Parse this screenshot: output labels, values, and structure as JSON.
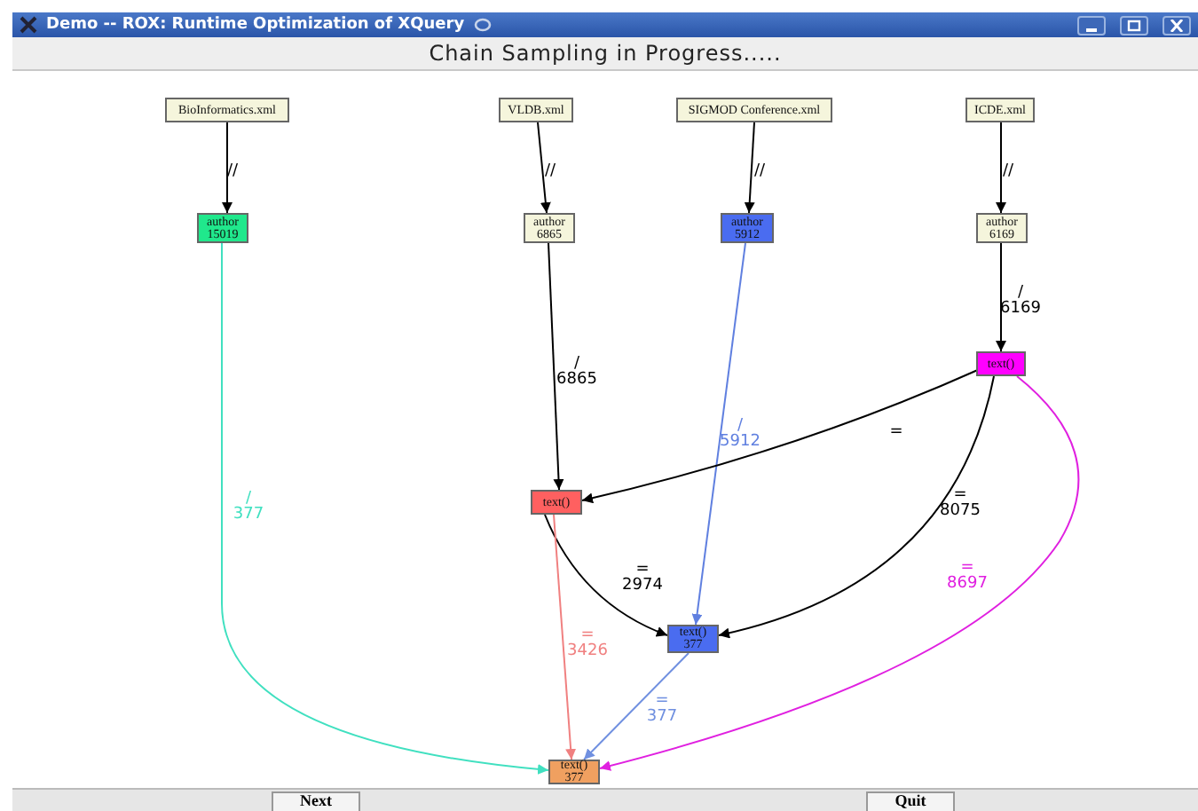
{
  "window": {
    "title": "Demo -- ROX: Runtime Optimization of XQuery"
  },
  "header": {
    "status": "Chain Sampling in Progress....."
  },
  "graph": {
    "nodes": [
      {
        "label": "BioInformatics.xml",
        "color": "#f5f5dc"
      },
      {
        "label": "VLDB.xml",
        "color": "#f5f5dc"
      },
      {
        "label": "SIGMOD Conference.xml",
        "color": "#f5f5dc"
      },
      {
        "label": "ICDE.xml",
        "color": "#f5f5dc"
      },
      {
        "label": "author",
        "count": "15019",
        "color": "#20e88c"
      },
      {
        "label": "author",
        "count": "6865",
        "color": "#f5f5dc"
      },
      {
        "label": "author",
        "count": "5912",
        "color": "#4a6cf0"
      },
      {
        "label": "author",
        "count": "6169",
        "color": "#f5f5dc"
      },
      {
        "label": "text()",
        "color": "#ff00ff"
      },
      {
        "label": "text()",
        "color": "#ff6060"
      },
      {
        "label": "text()",
        "count": "377",
        "color": "#4a6cf0"
      },
      {
        "label": "text()",
        "count": "377",
        "color": "#f0a060"
      }
    ],
    "edges": [
      {
        "operator": "//",
        "color": "#000000"
      },
      {
        "operator": "//",
        "color": "#000000"
      },
      {
        "operator": "//",
        "color": "#000000"
      },
      {
        "operator": "//",
        "color": "#000000"
      },
      {
        "operator": "/",
        "count": "6865",
        "color": "#000000"
      },
      {
        "operator": "/",
        "count": "6169",
        "color": "#000000"
      },
      {
        "operator": "/",
        "count": "377",
        "color": "#40e0c0"
      },
      {
        "operator": "/",
        "count": "5912",
        "color": "#6080e0"
      },
      {
        "operator": "=",
        "color": "#000000"
      },
      {
        "operator": "=",
        "count": "8075",
        "color": "#000000"
      },
      {
        "operator": "=",
        "count": "8697",
        "color": "#e020e0"
      },
      {
        "operator": "=",
        "count": "2974",
        "color": "#000000"
      },
      {
        "operator": "=",
        "count": "3426",
        "color": "#f08080"
      },
      {
        "operator": "=",
        "count": "377",
        "color": "#7090e0"
      }
    ]
  },
  "buttons": [
    {
      "label": "Next"
    },
    {
      "label": "Quit"
    }
  ]
}
